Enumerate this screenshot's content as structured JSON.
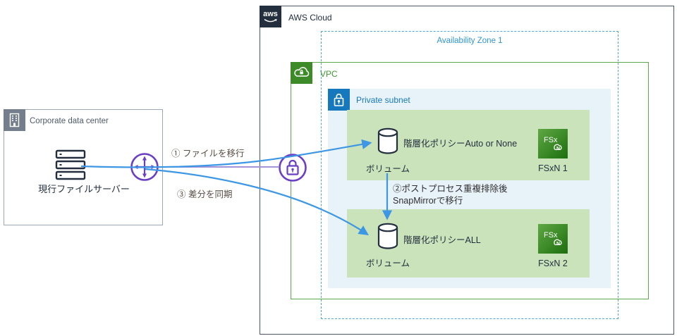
{
  "aws_cloud": {
    "label": "AWS Cloud"
  },
  "availability_zone": {
    "label": "Availability Zone 1"
  },
  "vpc": {
    "label": "VPC"
  },
  "private_subnet": {
    "label": "Private subnet"
  },
  "corporate_dc": {
    "label": "Corporate data center",
    "server_label": "現行ファイルサーバー"
  },
  "fsxn1": {
    "policy_label": "階層化ポリシーAuto or None",
    "volume_label": "ボリューム",
    "name": "FSxN 1"
  },
  "fsxn2": {
    "policy_label": "階層化ポリシーALL",
    "volume_label": "ボリューム",
    "name": "FSxN 2"
  },
  "annotations": {
    "step1": "① ファイルを移行",
    "step2_line1": "②ポストプロセス重複排除後",
    "step2_line2": "SnapMirrorで移行",
    "step3": "③ 差分を同期"
  },
  "icons": {
    "aws_logo_text": "aws",
    "fsx_text": "FSx",
    "fsx_letter": "N",
    "gateway": "four-way-arrows",
    "vpn": "padlock-in-circle",
    "vpc": "cloud-with-lock",
    "private_subnet": "padlock",
    "corporate_dc": "building",
    "file_server": "server-rack",
    "volume": "cylinder"
  },
  "colors": {
    "arrow_blue": "#3E97E5",
    "purple": "#6B3FC4",
    "purple_line": "#A393D9",
    "az_blue": "#2E96D5",
    "subnet_blue": "#1779BD",
    "vpc_green": "#3D9B2F",
    "green_box_fill": "#CAE3BB",
    "subnet_fill": "#E8F2F9",
    "dark_navy": "#232F3E",
    "fsxn_gradient_light": "#5FA844",
    "fsxn_gradient_dark": "#1C6E0E"
  }
}
